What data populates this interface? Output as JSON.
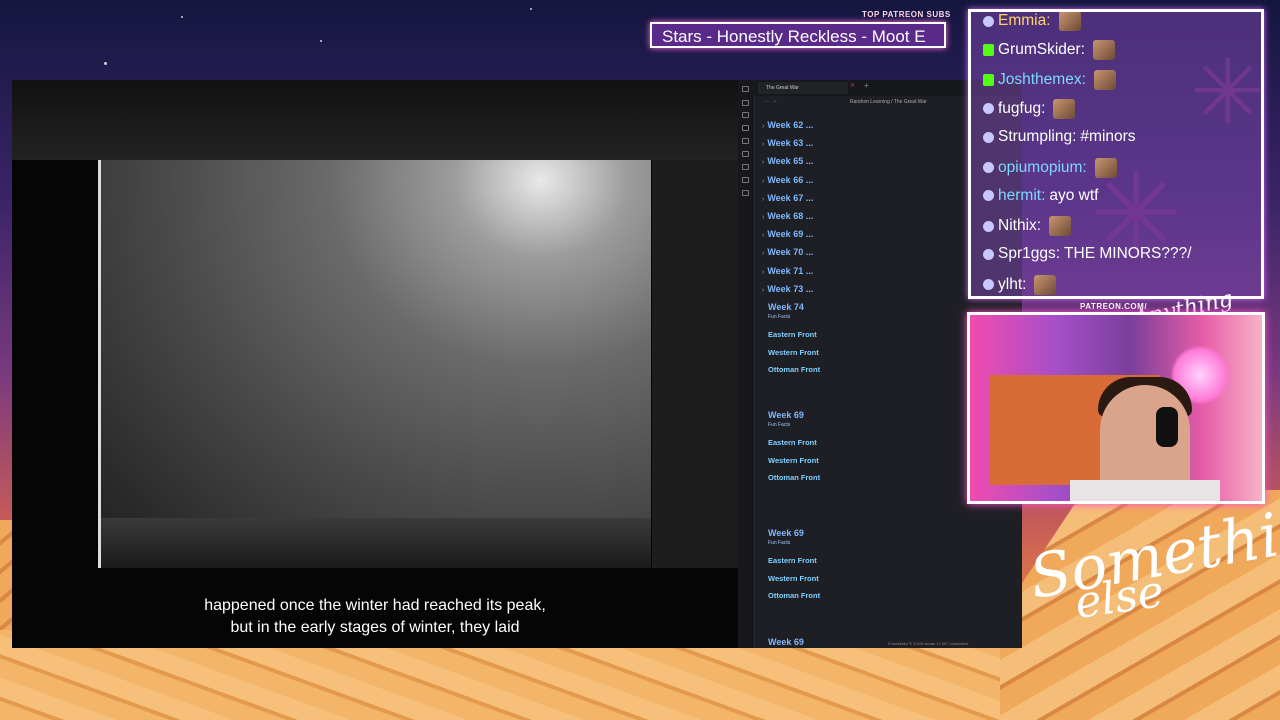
{
  "ticker": {
    "label": "TOP PATREON SUBS",
    "text": "Stars - Honestly Reckless - Moot E"
  },
  "video": {
    "subtitle_line1": "happened once the winter had reached its peak,",
    "subtitle_line2": "but in the early stages of winter, they laid"
  },
  "notes": {
    "tab_title": "The Great War",
    "breadcrumb": "Random Learning  /  The Great War",
    "collapsed_weeks": [
      "Week 62",
      "Week 63",
      "Week 65",
      "Week 66",
      "Week 67",
      "Week 68",
      "Week 69",
      "Week 70",
      "Week 71",
      "Week 73"
    ],
    "ellipsis": "...",
    "sections": [
      {
        "week": "Week 74",
        "fun": "Fun Facts",
        "fronts": [
          "Eastern Front",
          "Western Front",
          "Ottoman Front"
        ]
      },
      {
        "week": "Week 69",
        "fun": "Fun Facts",
        "fronts": [
          "Eastern Front",
          "Western Front",
          "Ottoman Front"
        ]
      },
      {
        "week": "Week 69",
        "fun": "Fun Facts",
        "fronts": [
          "Eastern Front",
          "Western Front",
          "Ottoman Front"
        ]
      }
    ],
    "last_week": "Week 69",
    "status": "0 backlinks   ✎   3,418 words   17,007 characters"
  },
  "chat": {
    "messages": [
      {
        "name": "Emmia:",
        "text": "",
        "color": "#ffd36a"
      },
      {
        "name": "GrumSkider:",
        "text": "",
        "color": "#ffffff"
      },
      {
        "name": "Joshthemex:",
        "text": "",
        "color": "#7fd8ff"
      },
      {
        "name": "fugfug:",
        "text": "",
        "color": "#ffffff"
      },
      {
        "name": "Strumpling:",
        "text": " #minors",
        "color": "#ffffff"
      },
      {
        "name": "opiumopium:",
        "text": "",
        "color": "#7fd8ff"
      },
      {
        "name": "hermit:",
        "text": " ayo wtf",
        "color": "#7fd8ff"
      },
      {
        "name": "Nithix:",
        "text": "",
        "color": "#ffffff"
      },
      {
        "name": "Spr1ggs:",
        "text": " THE MINORS???/",
        "color": "#ffffff"
      },
      {
        "name": "ylht:",
        "text": "",
        "color": "#ffffff"
      }
    ]
  },
  "cam": {
    "patreon_label": "PATREON.COM/"
  },
  "branding": {
    "logo_small": "Anything else?",
    "logo_large_1": "Something",
    "logo_large_2": "else"
  },
  "colors": {
    "accent_link": "#7fb8ff",
    "frame_glow": "#ff6fe0",
    "notes_bg": "#1e1f24"
  }
}
